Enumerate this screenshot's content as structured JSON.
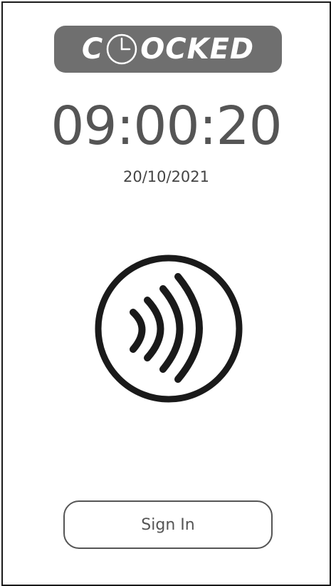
{
  "logo": {
    "prefix": "C",
    "suffix": "OCKED",
    "clock_icon": "clock-icon"
  },
  "clock": {
    "time": "09:00:20",
    "date": "20/10/2021"
  },
  "nfc": {
    "icon": "contactless-icon"
  },
  "actions": {
    "sign_in_label": "Sign In"
  },
  "colors": {
    "logo_bg": "#6f6f6f",
    "text": "#555555",
    "icon": "#1a1a1a"
  }
}
